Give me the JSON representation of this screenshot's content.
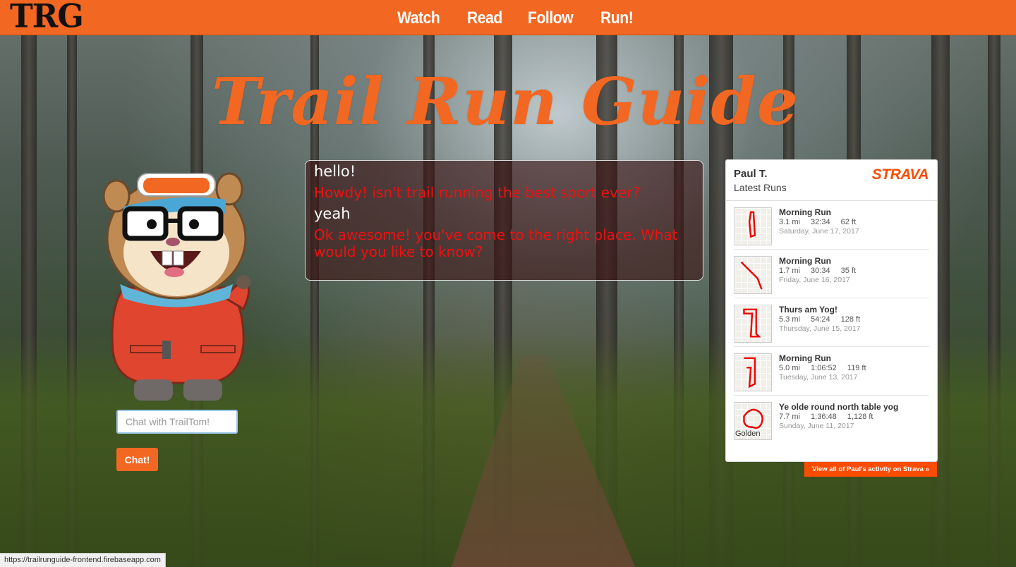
{
  "header": {
    "brand": "TRG",
    "nav": [
      "Watch",
      "Read",
      "Follow",
      "Run!"
    ]
  },
  "hero": {
    "title": "Trail Run Guide"
  },
  "chat": {
    "messages": [
      {
        "role": "user",
        "text": "hello!"
      },
      {
        "role": "bot",
        "text": "Howdy! isn't trail running the best sport ever?"
      },
      {
        "role": "user",
        "text": "yeah"
      },
      {
        "role": "bot",
        "text": "Ok awesome! you've come to the right place. What would you like to know?"
      }
    ],
    "input_placeholder": "Chat with TrailTom!",
    "button_label": "Chat!"
  },
  "strava": {
    "athlete": "Paul T.",
    "subtitle": "Latest Runs",
    "logo": "STRAVA",
    "runs": [
      {
        "name": "Morning Run",
        "distance": "3.1 mi",
        "time": "32:34",
        "elevation": "62 ft",
        "date": "Saturday, June 17, 2017"
      },
      {
        "name": "Morning Run",
        "distance": "1.7 mi",
        "time": "30:34",
        "elevation": "35 ft",
        "date": "Friday, June 16, 2017"
      },
      {
        "name": "Thurs am Yog!",
        "distance": "5.3 mi",
        "time": "54:24",
        "elevation": "128 ft",
        "date": "Thursday, June 15, 2017"
      },
      {
        "name": "Morning Run",
        "distance": "5.0 mi",
        "time": "1:06:52",
        "elevation": "119 ft",
        "date": "Tuesday, June 13, 2017"
      },
      {
        "name": "Ye olde round north table yog",
        "distance": "7.7 mi",
        "time": "1:36:48",
        "elevation": "1,128 ft",
        "date": "Sunday, June 11, 2017",
        "map_label": "Golden"
      }
    ],
    "footer_link": "View all of Paul's activity on Strava »"
  },
  "status_bar": {
    "url": "https://trailrunguide-frontend.firebaseapp.com"
  },
  "colors": {
    "accent": "#f26722",
    "strava": "#fc4c02",
    "bot_text": "#ee1111"
  }
}
